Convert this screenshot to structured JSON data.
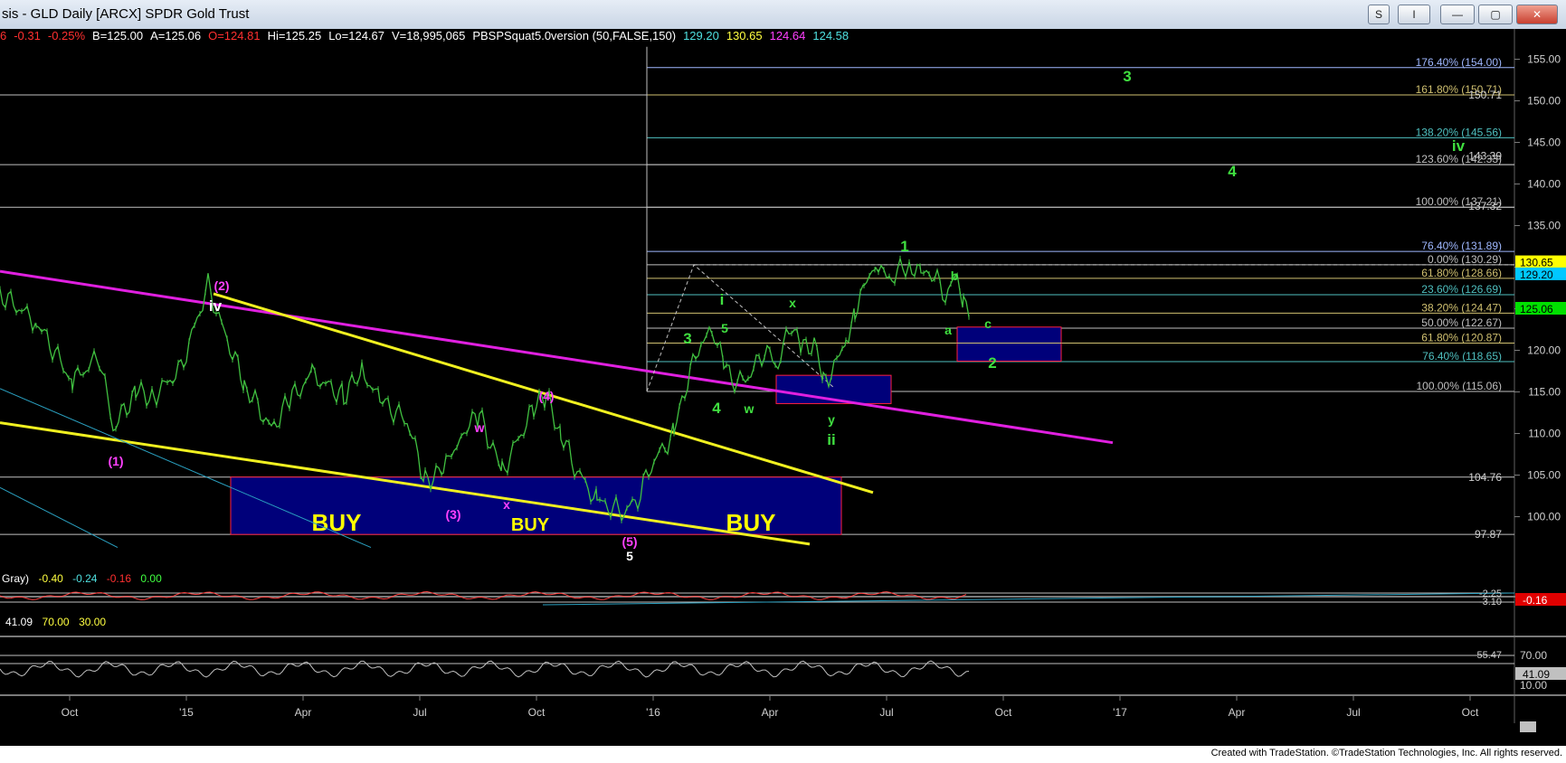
{
  "window": {
    "title": "sis - GLD Daily [ARCX] SPDR Gold Trust",
    "buttons": [
      "S",
      "I",
      "—",
      "▢",
      "✕"
    ]
  },
  "header": {
    "items": [
      {
        "text": "6",
        "color": "#ff3030"
      },
      {
        "text": "-0.31",
        "color": "#ff3030"
      },
      {
        "text": "-0.25%",
        "color": "#ff3030"
      },
      {
        "text": "B=125.00",
        "color": "#ffffff"
      },
      {
        "text": "A=125.06",
        "color": "#ffffff"
      },
      {
        "text": "O=124.81",
        "color": "#ff3030"
      },
      {
        "text": "Hi=125.25",
        "color": "#ffffff"
      },
      {
        "text": "Lo=124.67",
        "color": "#ffffff"
      },
      {
        "text": "V=18,995,065",
        "color": "#ffffff"
      },
      {
        "text": "PBSPSquat5.0version (50,FALSE,150)",
        "color": "#ffffff"
      },
      {
        "text": "129.20",
        "color": "#4fe0e0"
      },
      {
        "text": "130.65",
        "color": "#ffff40"
      },
      {
        "text": "124.64",
        "color": "#ff40ff"
      },
      {
        "text": "124.58",
        "color": "#4fe0e0"
      }
    ]
  },
  "indicator1": {
    "items": [
      {
        "text": "Gray)",
        "color": "#ffffff"
      },
      {
        "text": "-0.40",
        "color": "#ffff40"
      },
      {
        "text": "-0.24",
        "color": "#4fe0e0"
      },
      {
        "text": "-0.16",
        "color": "#ff3030"
      },
      {
        "text": "0.00",
        "color": "#40ff40"
      }
    ],
    "axis_labels": [
      "-2.25",
      "-3.10"
    ],
    "last_value": "-0.16"
  },
  "indicator2": {
    "items": [
      {
        "text": "41.09",
        "color": "#ffffff"
      },
      {
        "text": "70.00",
        "color": "#ffff40"
      },
      {
        "text": "30.00",
        "color": "#ffff40"
      }
    ],
    "axis_labels": [
      "70.00",
      "10.00",
      "55.47"
    ],
    "last_value": "41.09"
  },
  "chart_data": {
    "type": "line",
    "title": "GLD Daily [ARCX] SPDR Gold Trust",
    "ylim": [
      96,
      159
    ],
    "y_ticks": [
      100,
      105,
      110,
      115,
      120,
      125,
      130,
      135,
      140,
      145,
      150,
      155
    ],
    "x_ticks": [
      "Oct",
      "'15",
      "Apr",
      "Jul",
      "Oct",
      "'16",
      "Apr",
      "Jul",
      "Oct",
      "'17",
      "Apr",
      "Jul",
      "Oct"
    ],
    "price_tags": [
      {
        "value": 130.65,
        "label": "130.65",
        "bg": "#ffff00",
        "fg": "#000000"
      },
      {
        "value": 129.2,
        "label": "129.20",
        "bg": "#00c8ff",
        "fg": "#000000"
      },
      {
        "value": 125.06,
        "label": "125.06",
        "bg": "#00e000",
        "fg": "#000000"
      }
    ],
    "static_axis_labels": [
      {
        "value": 104.76,
        "label": "104.76"
      },
      {
        "value": 97.87,
        "label": "97.87"
      },
      {
        "value": 143.39,
        "label": "143.39"
      },
      {
        "value": 137.32,
        "label": "137.32"
      },
      {
        "value": 150.71,
        "label": "150.71"
      }
    ],
    "fib_levels": [
      {
        "label": "176.40% (154.00)",
        "value": 154.0,
        "color": "#9fb8ff"
      },
      {
        "label": "161.80% (150.71)",
        "value": 150.71,
        "color": "#d0c070"
      },
      {
        "label": "138.20% (145.56)",
        "value": 145.56,
        "color": "#4fc0c0"
      },
      {
        "label": "123.60% (142.33)",
        "value": 142.33,
        "color": "#c0c0c0"
      },
      {
        "label": "100.00% (137.21)",
        "value": 137.21,
        "color": "#c0c0c0"
      },
      {
        "label": "76.40% (131.89)",
        "value": 131.89,
        "color": "#9fb8ff"
      },
      {
        "label": "0.00% (130.29)",
        "value": 130.29,
        "color": "#c0c0c0"
      },
      {
        "label": "61.80% (128.66)",
        "value": 128.66,
        "color": "#d0c070"
      },
      {
        "label": "23.60% (126.69)",
        "value": 126.69,
        "color": "#4fc0c0"
      },
      {
        "label": "38.20% (124.47)",
        "value": 124.47,
        "color": "#d0c070"
      },
      {
        "label": "50.00% (122.67)",
        "value": 122.67,
        "color": "#c0c0c0"
      },
      {
        "label": "61.80% (120.87)",
        "value": 120.87,
        "color": "#d0c070"
      },
      {
        "label": "76.40% (118.65)",
        "value": 118.65,
        "color": "#4fc0c0"
      },
      {
        "label": "100.00% (115.06)",
        "value": 115.06,
        "color": "#c0c0c0"
      }
    ],
    "wave_labels": [
      {
        "text": "(2)",
        "color": "#ff40ff",
        "x": "'15 Feb",
        "y": 128.5
      },
      {
        "text": "iv",
        "color": "#ffffff",
        "x": "'15 Feb",
        "y": 126.3
      },
      {
        "text": "(1)",
        "color": "#ff40ff",
        "x": "'14 Nov",
        "y": 108.9
      },
      {
        "text": "w",
        "color": "#ff40ff",
        "x": "'15 Aug",
        "y": 112.0
      },
      {
        "text": "x",
        "color": "#ff40ff",
        "x": "'15 Aug",
        "y": 103.9
      },
      {
        "text": "(3)",
        "color": "#ff40ff",
        "x": "'15 Jul",
        "y": 101.7
      },
      {
        "text": "(4)",
        "color": "#ff40ff",
        "x": "'15 Oct",
        "y": 115.5
      },
      {
        "text": "(5)",
        "color": "#ff40ff",
        "x": "'15 Dec",
        "y": 98.9
      },
      {
        "text": "5",
        "color": "#ffffff",
        "x": "'15 Dec",
        "y": 97.6
      },
      {
        "text": "3",
        "color": "#40e040",
        "x": "'16 Feb",
        "y": 121.8
      },
      {
        "text": "i",
        "color": "#40e040",
        "x": "'16 Mar",
        "y": 127.0
      },
      {
        "text": "5",
        "color": "#40e040",
        "x": "'16 Mar",
        "y": 122.7
      },
      {
        "text": "4",
        "color": "#40e040",
        "x": "'16 Feb",
        "y": 114.2
      },
      {
        "text": "w",
        "color": "#40e040",
        "x": "'16 Mar",
        "y": 114.2
      },
      {
        "text": "x",
        "color": "#40e040",
        "x": "'16 May",
        "y": 126.2
      },
      {
        "text": "y",
        "color": "#40e040",
        "x": "'16 Jun",
        "y": 113.5
      },
      {
        "text": "ii",
        "color": "#40e040",
        "x": "'16 Jun",
        "y": 110.5
      },
      {
        "text": "1",
        "color": "#40e040",
        "x": "'16 Jul",
        "y": 133.5
      },
      {
        "text": "b",
        "color": "#40e040",
        "x": "'16 Sep",
        "y": 129.8
      },
      {
        "text": "a",
        "color": "#40e040",
        "x": "'16 Aug",
        "y": 123.5
      },
      {
        "text": "c",
        "color": "#40e040",
        "x": "'16 Sep",
        "y": 121.8
      },
      {
        "text": "2",
        "color": "#40e040",
        "x": "'16 Sep",
        "y": 119.5
      },
      {
        "text": "3",
        "color": "#40e040",
        "x": "'16 Nov",
        "y": 152.5
      },
      {
        "text": "4",
        "color": "#40e040",
        "x": "'17 Apr",
        "y": 141.2
      },
      {
        "text": "iv",
        "color": "#40e040",
        "x": "'17 Sep",
        "y": 143.4
      }
    ],
    "buy_zones": [
      {
        "label": "BUY",
        "from": "'15 Feb",
        "to": "'16 Jun",
        "top": 104.76,
        "bottom": 97.87
      }
    ],
    "target_boxes": [
      {
        "from": "'16 May",
        "to": "'16 Jun",
        "top": 117.0,
        "bottom": 113.6
      },
      {
        "from": "'16 Sep",
        "to": "'16 Oct",
        "top": 122.8,
        "bottom": 118.7
      }
    ]
  },
  "footer": {
    "credit": "Created with TradeStation. ©TradeStation Technologies, Inc. All rights reserved."
  }
}
